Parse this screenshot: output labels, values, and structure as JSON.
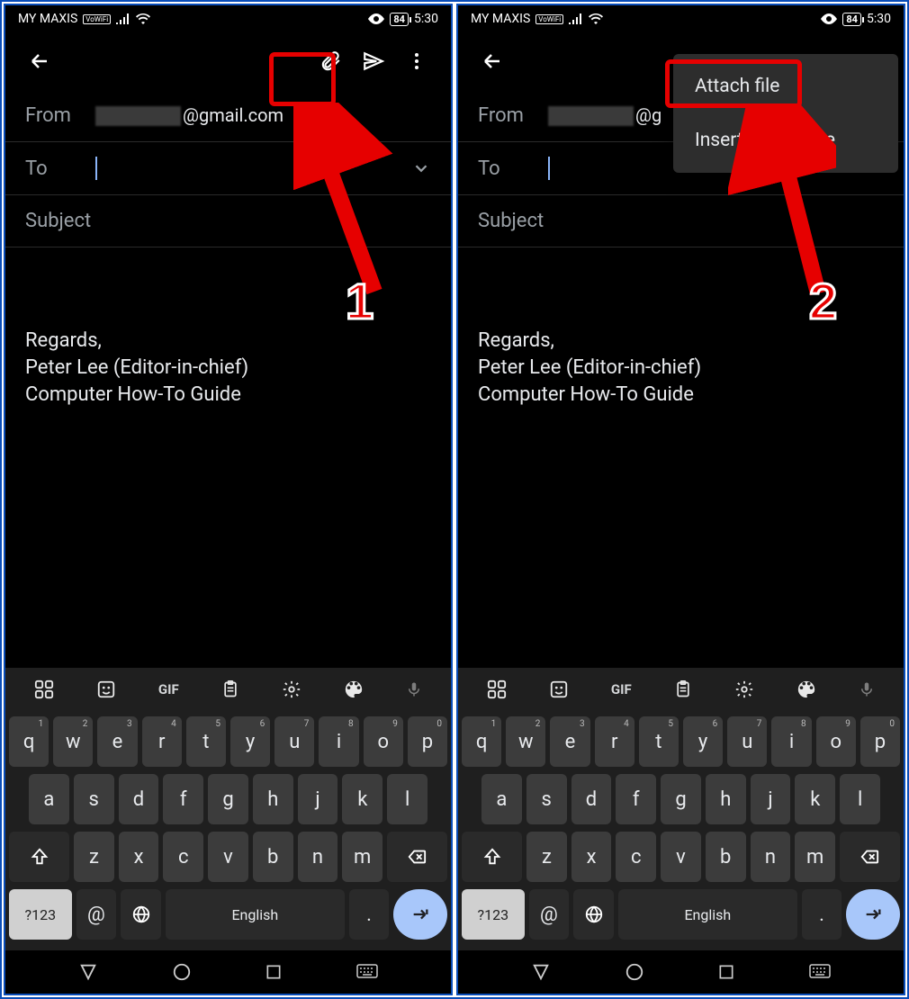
{
  "statusbar": {
    "carrier": "MY MAXIS",
    "vowifi": "VoWiFi",
    "battery": "84",
    "time": "5:30"
  },
  "compose": {
    "from_label": "From",
    "from_suffix": "@gmail.com",
    "to_label": "To",
    "subject_placeholder": "Subject",
    "body": "\n\nRegards,\nPeter Lee (Editor-in-chief)\nComputer How-To Guide"
  },
  "menu": {
    "attach_file": "Attach file",
    "insert_drive": "Insert from Drive"
  },
  "keyboard": {
    "row1": [
      "q",
      "w",
      "e",
      "r",
      "t",
      "y",
      "u",
      "i",
      "o",
      "p"
    ],
    "row1_sup": [
      "1",
      "2",
      "3",
      "4",
      "5",
      "6",
      "7",
      "8",
      "9",
      "0"
    ],
    "row2": [
      "a",
      "s",
      "d",
      "f",
      "g",
      "h",
      "j",
      "k",
      "l"
    ],
    "row3": [
      "z",
      "x",
      "c",
      "v",
      "b",
      "n",
      "m"
    ],
    "sym": "?123",
    "space": "English",
    "gif": "GIF"
  },
  "annotations": {
    "step1": "1",
    "step2": "2"
  }
}
